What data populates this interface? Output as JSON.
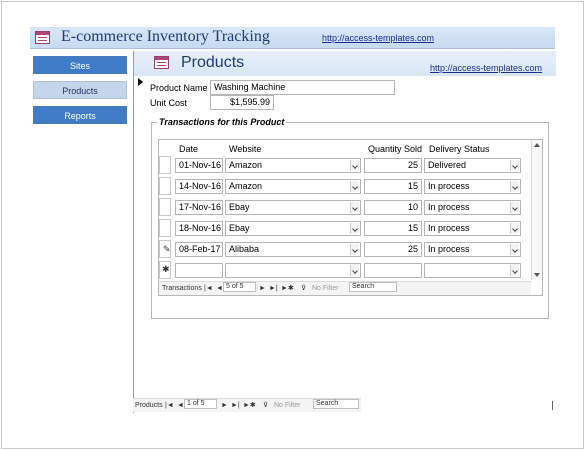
{
  "app": {
    "title": "E-commerce Inventory Tracking",
    "link": "http://access-templates.com"
  },
  "sidebar": {
    "items": [
      {
        "label": "Sites"
      },
      {
        "label": "Products"
      },
      {
        "label": "Reports"
      }
    ]
  },
  "form": {
    "title": "Products",
    "link": "http://access-templates.com",
    "product_name_label": "Product Name",
    "product_name_value": "Washing Machine",
    "unit_cost_label": "Unit Cost",
    "unit_cost_value": "$1,595.99"
  },
  "transactions": {
    "group_title": "Transactions for this Product",
    "columns": [
      "Date",
      "Website",
      "Quantity Sold",
      "Delivery Status"
    ],
    "rows": [
      {
        "date": "01-Nov-16",
        "website": "Amazon",
        "qty": "25",
        "status": "Delivered"
      },
      {
        "date": "14-Nov-16",
        "website": "Amazon",
        "qty": "15",
        "status": "In process"
      },
      {
        "date": "17-Nov-16",
        "website": "Ebay",
        "qty": "10",
        "status": "In process"
      },
      {
        "date": "18-Nov-16",
        "website": "Ebay",
        "qty": "15",
        "status": "In process"
      },
      {
        "date": "08-Feb-17",
        "website": "Alibaba",
        "qty": "25",
        "status": "In process"
      }
    ],
    "nav": {
      "label": "Transactions",
      "record": "5 of 5",
      "filter": "No Filter",
      "search": "Search"
    }
  },
  "form_nav": {
    "label": "Products",
    "record": "1 of 5",
    "filter": "No Filter",
    "search": "Search"
  },
  "icons": {
    "app": "form-icon",
    "products": "form-icon",
    "edit_row": "pencil-icon",
    "new_row": "asterisk-icon",
    "dropdown": "chevron-down-icon"
  },
  "colors": {
    "accent": "#3f7bc6",
    "title_text": "#1d3c72"
  }
}
